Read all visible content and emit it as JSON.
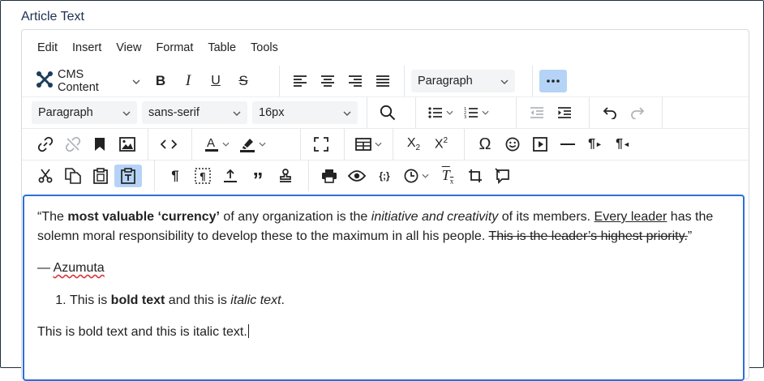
{
  "field": {
    "label": "Article Text"
  },
  "menubar": {
    "items": [
      "Edit",
      "Insert",
      "View",
      "Format",
      "Table",
      "Tools"
    ]
  },
  "toolbar": {
    "cms_content_label": "CMS Content",
    "block_format_value": "Paragraph",
    "block_format_value_2": "Paragraph",
    "font_family_value": "sans-serif",
    "font_size_value": "16px"
  },
  "colors": {
    "accent": "#2e6fd6",
    "active_button": "#b5d3f7",
    "joomla_dark": "#1c3d5a"
  },
  "content": {
    "quote": {
      "open_quote": "“The ",
      "bold": "most valuable ‘currency’",
      "text_1": " of any organization is the ",
      "italic": "initiative and creativity",
      "text_2": " of its members. ",
      "underlined": "Every leader",
      "text_3": " has the solemn moral responsibility to develop these to the maximum in all his people. ",
      "strike": "This is the leader’s highest priority.",
      "close_quote": "”"
    },
    "attribution": {
      "dash": "— ",
      "name": "Azumuta"
    },
    "list_item": {
      "text_1": "This is ",
      "bold": "bold text",
      "text_2": " and this is ",
      "italic": "italic text",
      "text_3": "."
    },
    "plain_line": "This is bold text and this is italic text."
  }
}
